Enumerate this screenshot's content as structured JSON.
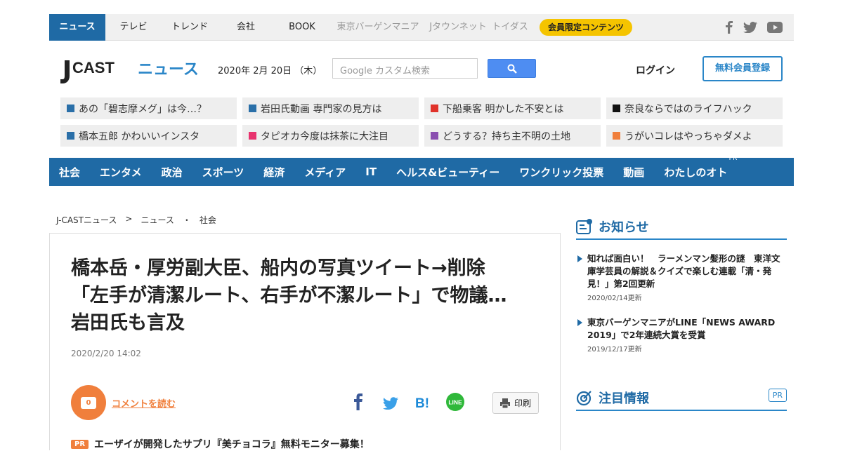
{
  "topnav": {
    "items": [
      {
        "label": "ニュース",
        "active": true
      },
      {
        "label": "テレビ"
      },
      {
        "label": "トレンド"
      },
      {
        "label": "会社"
      },
      {
        "label": "BOOK"
      },
      {
        "label": "東京バーゲンマニア",
        "muted": true
      },
      {
        "label": "Jタウンネット",
        "muted": true
      },
      {
        "label": "トイダス",
        "muted": true
      }
    ],
    "members_label": "会員限定コンテンツ"
  },
  "header": {
    "logo_text": "J-CASTニュース",
    "date": "2020年 2月 20日 （木）",
    "search_placeholder": "Google カスタム検索",
    "login_label": "ログイン",
    "register_label": "無料会員登録"
  },
  "trending": [
    {
      "label": "あの「碧志摩メグ」は今…？",
      "color": "#2a6fa8"
    },
    {
      "label": "岩田氏動画 専門家の見方は",
      "color": "#2a6fa8"
    },
    {
      "label": "下船乗客 明かした不安とは",
      "color": "#e0322a"
    },
    {
      "label": "奈良ならではのライフハック",
      "color": "#111111"
    },
    {
      "label": "橋本五郎 かわいいインスタ",
      "color": "#2a6fa8"
    },
    {
      "label": "タピオカ今度は抹茶に大注目",
      "color": "#e8326e"
    },
    {
      "label": "どうする？持ち主不明の土地",
      "color": "#8a4fb0"
    },
    {
      "label": "うがいコレはやっちゃダメよ",
      "color": "#f07f3c"
    }
  ],
  "catnav": {
    "items": [
      "社会",
      "エンタメ",
      "政治",
      "スポーツ",
      "経済",
      "メディア",
      "IT",
      "ヘルス&ビューティー",
      "ワンクリック投票",
      "動画",
      "わたしのオト"
    ],
    "pr_label": "PR"
  },
  "breadcrumb": [
    "J-CASTニュース",
    ">",
    "ニュース",
    "・",
    "社会"
  ],
  "article": {
    "headline_lines": [
      "橋本岳・厚労副大臣、船内の写真ツイート→削除",
      "「左手が清潔ルート、右手が不潔ルート」で物議…",
      "岩田氏も言及"
    ],
    "timestamp": "2020/2/20 14:02",
    "comment_count": "0",
    "comment_link": "コメントを読む",
    "print_label": "印刷",
    "pr_tag": "PR",
    "pr_text": "エーザイが開発したサプリ『美チョコラ』無料モニター募集！"
  },
  "sidebar": {
    "notice_title": "お知らせ",
    "notices": [
      {
        "text": "知れば面白い！　ラーメンマン髪形の謎　東洋文庫学芸員の解説＆クイズで楽しむ連載「清・発見！」第2回更新",
        "date": "2020/02/14更新"
      },
      {
        "text": "東京バーゲンマニアがLINE「NEWS AWARD 2019」で2年連続大賞を受賞",
        "date": "2019/12/17更新"
      }
    ],
    "featured_title": "注目情報",
    "featured_pr": "PR"
  },
  "colors": {
    "brand": "#1f6aa5",
    "accent": "#f07f3c",
    "member_badge": "#f5c400"
  }
}
